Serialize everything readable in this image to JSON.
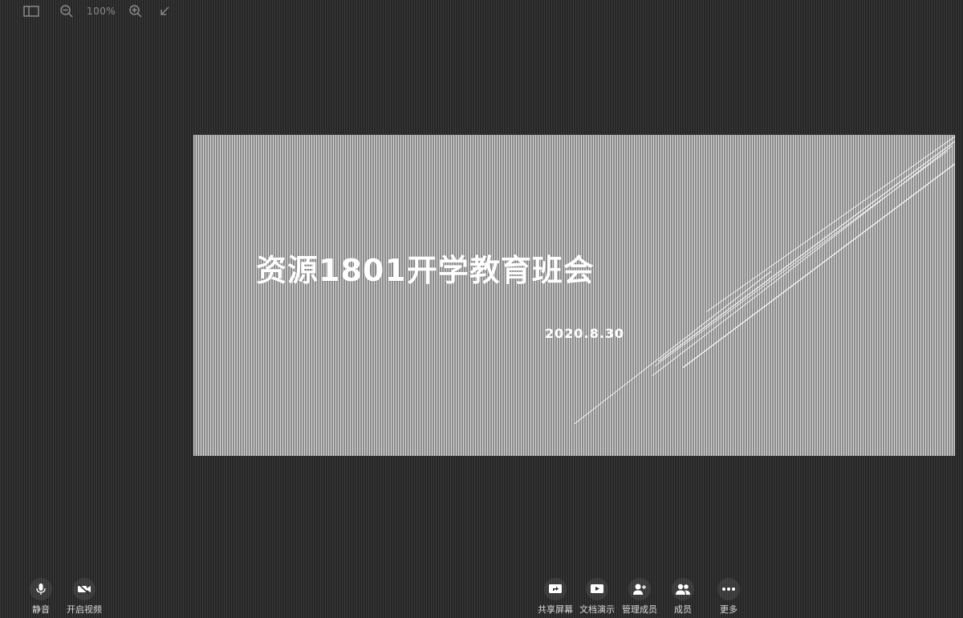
{
  "toolbar": {
    "zoom_level": "100%",
    "icons": [
      "layout-icon",
      "zoom-out-icon",
      "zoom-in-icon",
      "collapse-icon"
    ]
  },
  "slide": {
    "title": "资源1801开学教育班会",
    "date": "2020.8.30"
  },
  "controls": {
    "left": [
      {
        "icon": "microphone-icon",
        "label": "静音"
      },
      {
        "icon": "camera-off-icon",
        "label": "开启视频"
      }
    ],
    "right": [
      {
        "icon": "share-screen-icon",
        "label": "共享屏幕"
      },
      {
        "icon": "stop-share-icon",
        "label": "文档演示"
      },
      {
        "icon": "manage-members-icon",
        "label": "管理成员"
      },
      {
        "icon": "members-icon",
        "label": "成员"
      },
      {
        "icon": "more-icon",
        "label": "更多"
      }
    ]
  },
  "colors": {
    "background": "#2d2d2d",
    "slide_light": "#d6d6d6",
    "slide_text": "#ffffff",
    "control_text": "#dcdcdc"
  }
}
